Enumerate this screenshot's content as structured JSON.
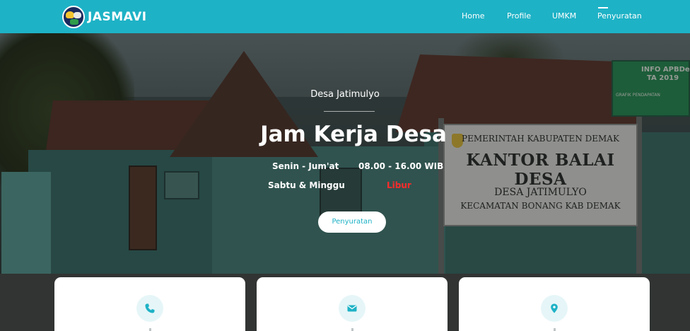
{
  "navbar": {
    "brand": "JASMAVI",
    "links": [
      "Home",
      "Profile",
      "UMKM",
      "Penyuratan"
    ],
    "active": "Penyuratan",
    "color": "#1eb2c6"
  },
  "hero": {
    "subtitle": "Desa Jatimulyo",
    "title": "Jam Kerja Desa",
    "schedule": [
      {
        "days": "Senin - Jum'at",
        "hours": "08.00 - 16.00 WIB"
      },
      {
        "days": "Sabtu & Minggu",
        "hours": "Libur"
      }
    ],
    "button_label": "Penyuratan",
    "closed_color": "#ff2b2b"
  },
  "background_sign": {
    "line1": "PEMERINTAH KABUPATEN DEMAK",
    "line2": "KANTOR BALAI DESA",
    "line3": "DESA JATIMULYO",
    "line4": "KECAMATAN BONANG KAB DEMAK"
  },
  "background_info_board": {
    "line1": "INFO APBDes",
    "line2": "TA 2019",
    "line3": "GRAFIK PENDAPATAN"
  },
  "cards": [
    {
      "icon": "phone-icon"
    },
    {
      "icon": "envelope-icon"
    },
    {
      "icon": "map-pin-icon"
    }
  ]
}
